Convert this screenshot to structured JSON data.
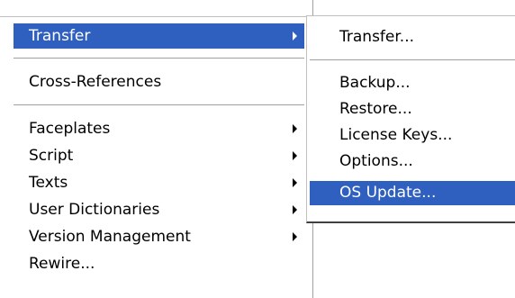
{
  "main_menu": {
    "items": [
      {
        "label": "Transfer",
        "has_submenu": true,
        "selected": true
      },
      {
        "label": "Cross-References",
        "has_submenu": false
      },
      {
        "label": "Faceplates",
        "has_submenu": true
      },
      {
        "label": "Script",
        "has_submenu": true
      },
      {
        "label": "Texts",
        "has_submenu": true
      },
      {
        "label": "User Dictionaries",
        "has_submenu": true
      },
      {
        "label": "Version Management",
        "has_submenu": true
      },
      {
        "label": "Rewire...",
        "has_submenu": false
      }
    ]
  },
  "sub_menu": {
    "items": [
      {
        "label": "Transfer..."
      },
      {
        "label": "Backup..."
      },
      {
        "label": "Restore..."
      },
      {
        "label": "License Keys..."
      },
      {
        "label": "Options..."
      },
      {
        "label": "OS Update...",
        "selected": true
      }
    ]
  },
  "colors": {
    "selection": "#2f5fbf",
    "menu_background": "#ffffff"
  }
}
